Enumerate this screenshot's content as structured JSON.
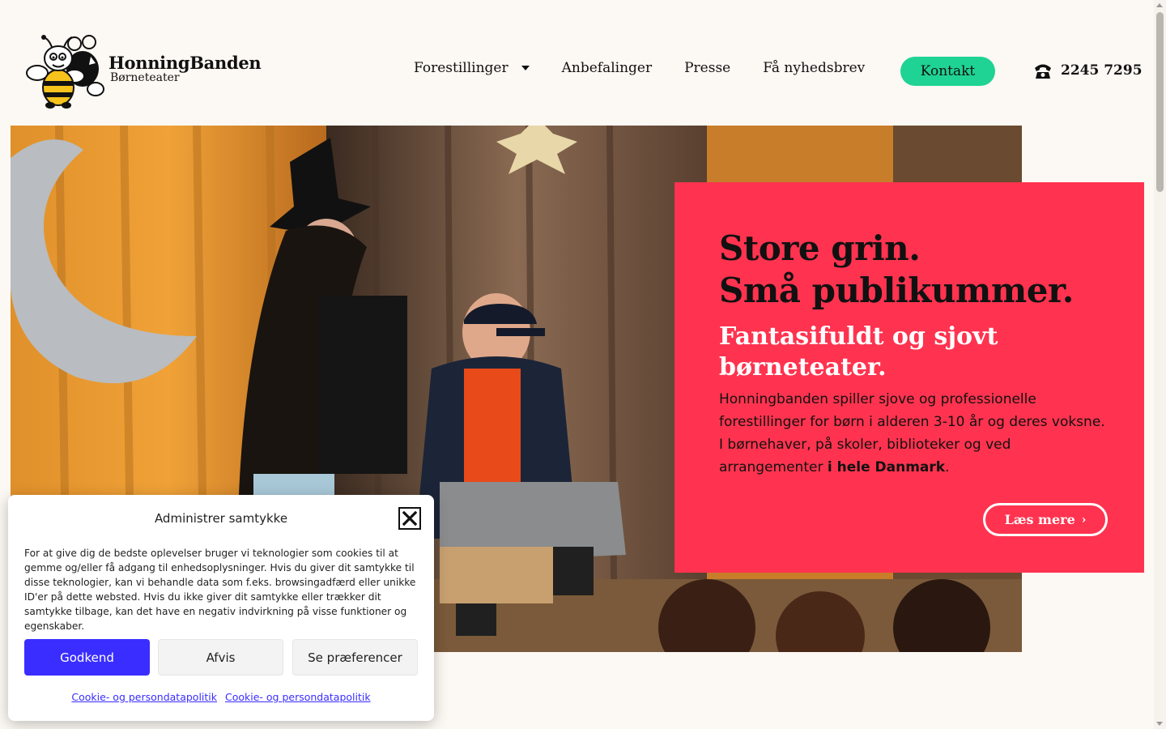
{
  "header": {
    "logo_name": "HonningBanden",
    "logo_sub": "Børneteater",
    "nav": [
      {
        "label": "Forestillinger"
      },
      {
        "label": "Anbefalinger"
      },
      {
        "label": "Presse"
      },
      {
        "label": "Få nyhedsbrev"
      }
    ],
    "contact_label": "Kontakt",
    "phone": "2245 7295",
    "colors": {
      "contact_bg": "#1fd394"
    }
  },
  "hero": {
    "title_line1": "Store grin.",
    "title_line2": "Små publikummer.",
    "subtitle": "Fantasifuldt og sjovt børneteater.",
    "text": "Honningbanden spiller sjove og professionelle forestillinger for børn i alderen 3-10 år og deres voksne. I børnehaver, på skoler, biblioteker og ved arrangementer ",
    "text_bold": "i hele Danmark",
    "text_end": ".",
    "cta_label": "Læs mere",
    "colors": {
      "card_bg": "#ff334f"
    }
  },
  "cookie": {
    "title": "Administrer samtykke",
    "body": "For at give dig de bedste oplevelser bruger vi teknologier som cookies til at gemme og/eller få adgang til enhedsoplysninger. Hvis du giver dit samtykke til disse teknologier, kan vi behandle data som f.eks. browsingadfærd eller unikke ID'er på dette websted. Hvis du ikke giver dit samtykke eller trækker dit samtykke tilbage, kan det have en negativ indvirkning på visse funktioner og egenskaber.",
    "accept_label": "Godkend",
    "deny_label": "Afvis",
    "prefs_label": "Se præferencer",
    "links": [
      "Cookie- og persondatapolitik",
      "Cookie- og persondatapolitik"
    ],
    "colors": {
      "accept_bg": "#3a2dff"
    }
  }
}
